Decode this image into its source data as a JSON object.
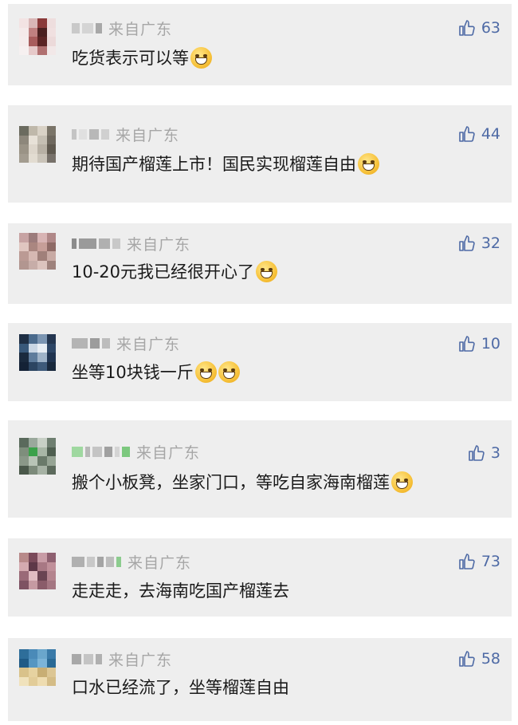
{
  "comments": [
    {
      "region": "来自广东",
      "text": "吃货表示可以等",
      "likes": "63"
    },
    {
      "region": "来自广东",
      "text": "期待国产榴莲上市！国民实现榴莲自由",
      "likes": "44"
    },
    {
      "region": "来自广东",
      "text": "10-20元我已经很开心了",
      "likes": "32"
    },
    {
      "region": "来自广东",
      "text": "坐等10块钱一斤",
      "likes": "10"
    },
    {
      "region": "来自广东",
      "text": "搬个小板凳，坐家门口，等吃自家海南榴莲",
      "likes": "3"
    },
    {
      "region": "来自广东",
      "text": "走走走，去海南吃国产榴莲去",
      "likes": "73"
    },
    {
      "region": "来自广东",
      "text": "口水已经流了，坐等榴莲自由",
      "likes": "58"
    }
  ],
  "icons": {
    "like": "thumbs-up-icon",
    "emoji": "emoji-face-icon",
    "avatar": "pixelated-avatar"
  },
  "colors": {
    "card_bg": "#eeeeee",
    "region": "#a6a6a6",
    "like": "#4e6aa5",
    "text": "#1a1a1a"
  }
}
